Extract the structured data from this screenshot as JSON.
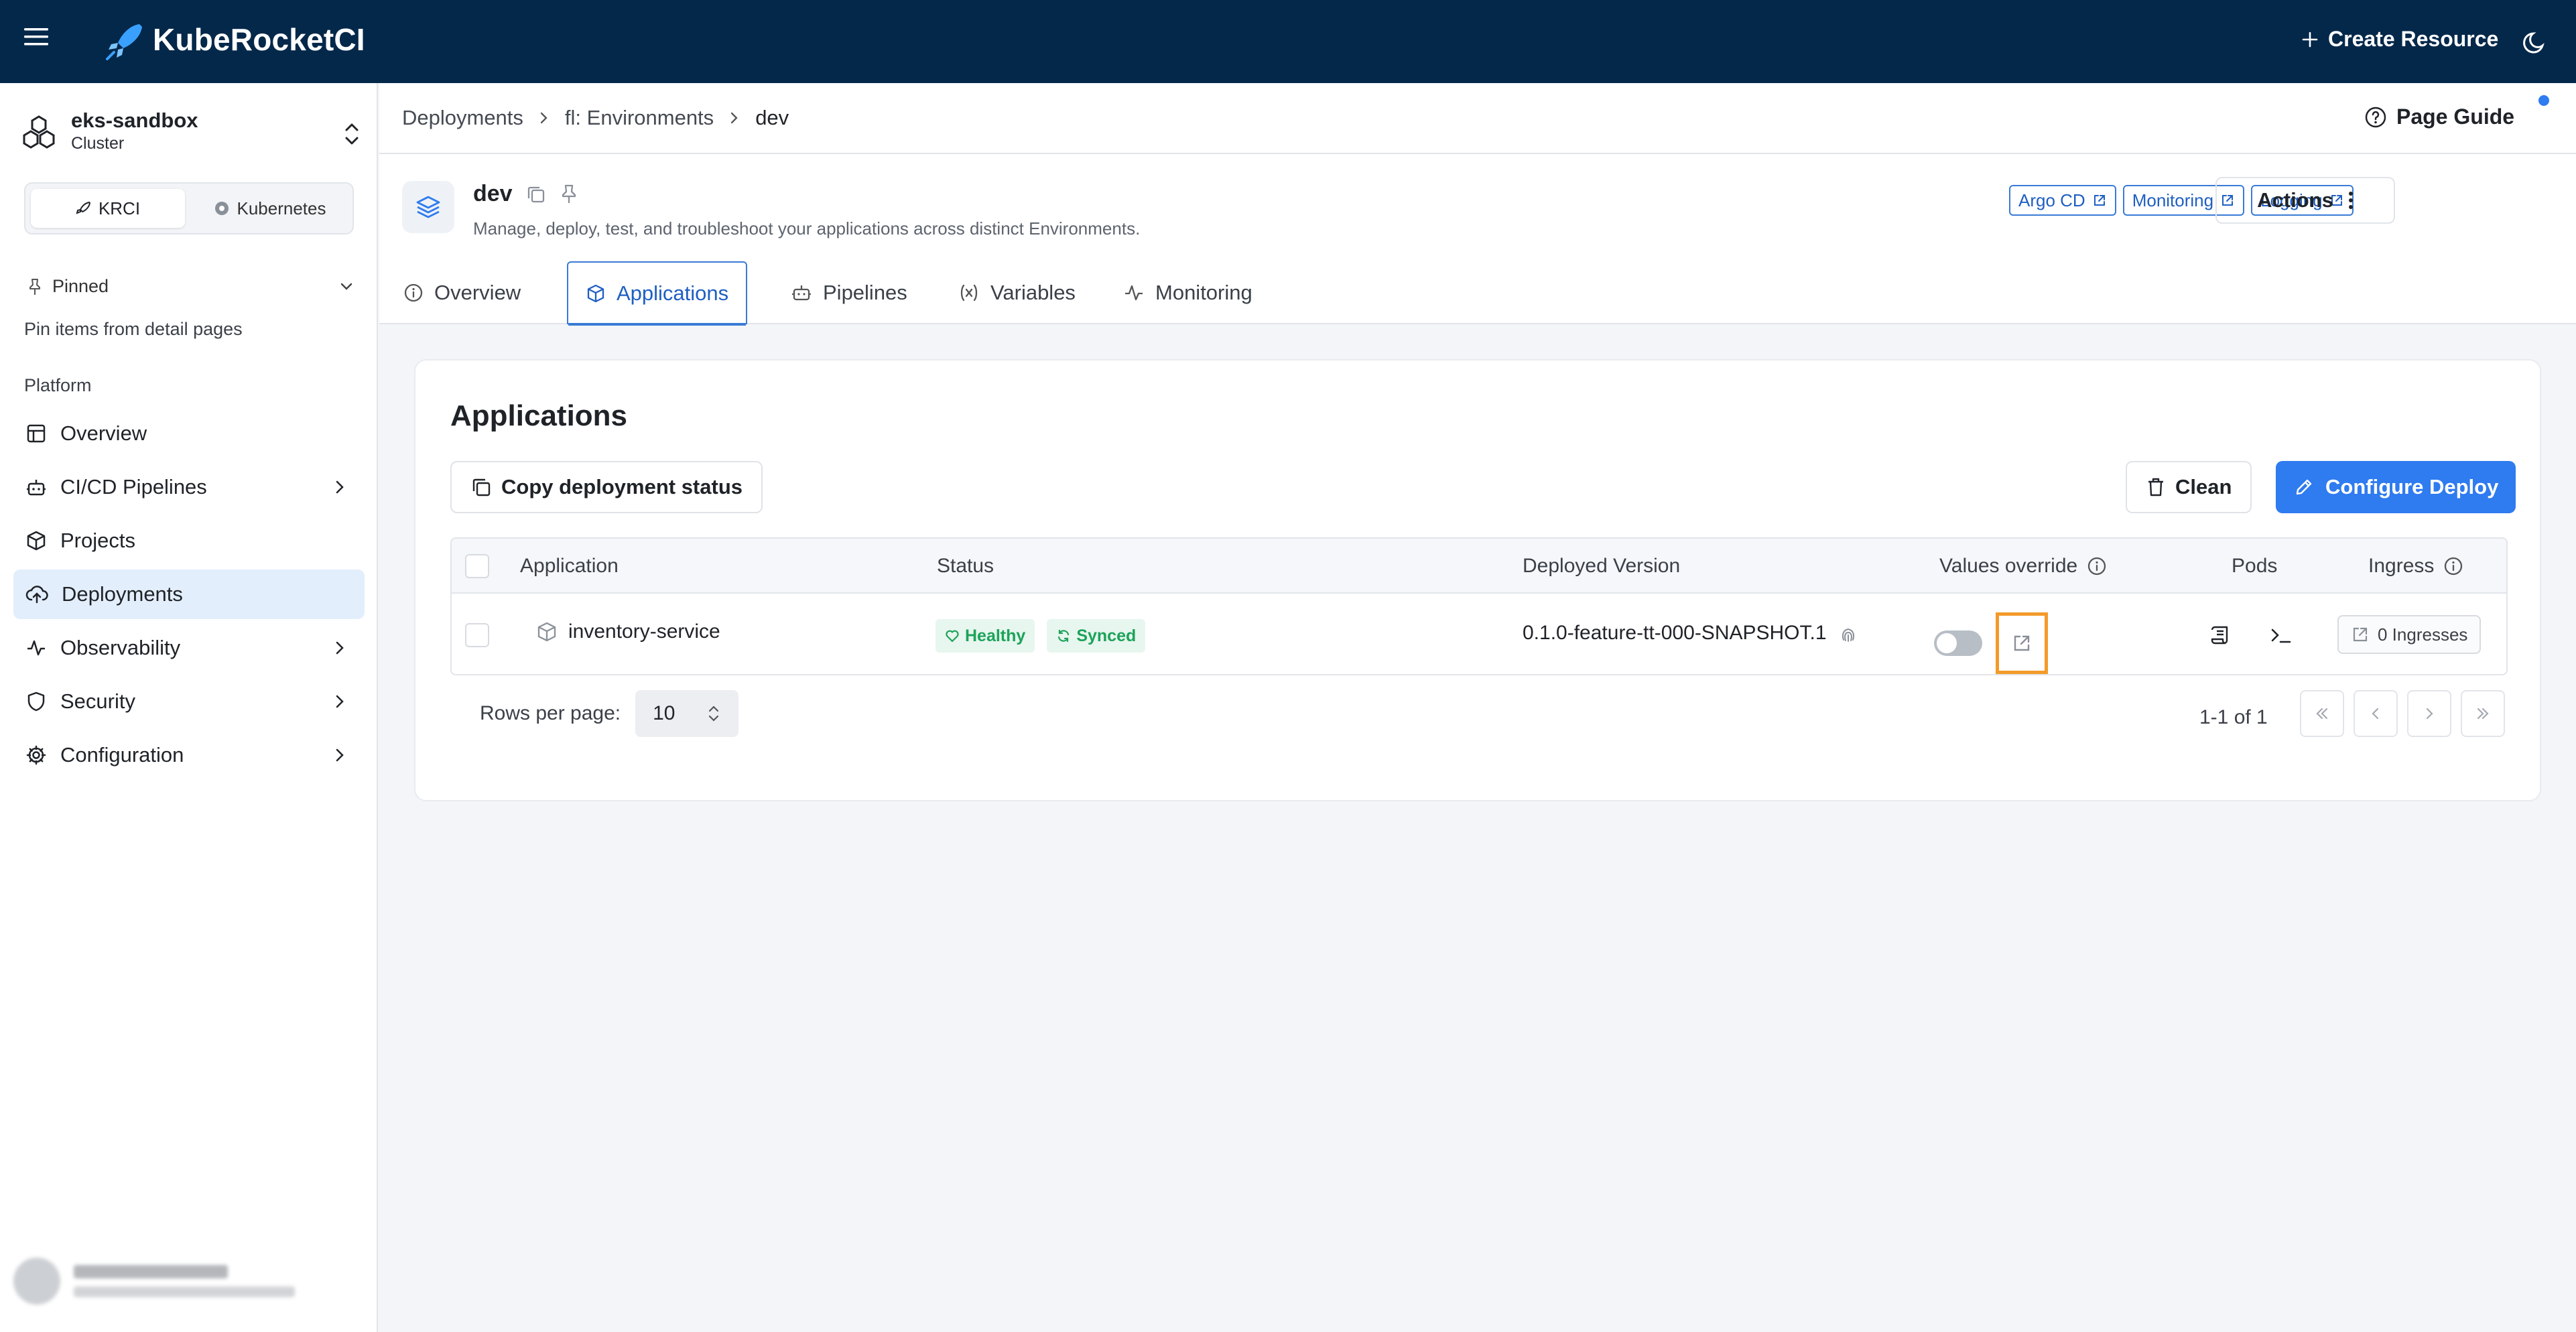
{
  "app": {
    "brand": "KubeRocketCI",
    "create_resource_label": "Create Resource"
  },
  "sidebar": {
    "cluster_name": "eks-sandbox",
    "cluster_type": "Cluster",
    "mode_options": [
      "KRCI",
      "Kubernetes"
    ],
    "active_mode": "KRCI",
    "pinned_label": "Pinned",
    "pinned_hint": "Pin items from detail pages",
    "section_label": "Platform",
    "items": [
      {
        "label": "Overview",
        "icon": "layout-icon",
        "expandable": false
      },
      {
        "label": "CI/CD Pipelines",
        "icon": "bot-icon",
        "expandable": true
      },
      {
        "label": "Projects",
        "icon": "box-icon",
        "expandable": false
      },
      {
        "label": "Deployments",
        "icon": "cloud-upload-icon",
        "expandable": false,
        "active": true
      },
      {
        "label": "Observability",
        "icon": "activity-icon",
        "expandable": true
      },
      {
        "label": "Security",
        "icon": "shield-icon",
        "expandable": true
      },
      {
        "label": "Configuration",
        "icon": "gear-icon",
        "expandable": true
      }
    ]
  },
  "breadcrumbs": [
    "Deployments",
    "fl: Environments",
    "dev"
  ],
  "page_guide_label": "Page Guide",
  "environment": {
    "name": "dev",
    "description": "Manage, deploy, test, and troubleshoot your applications across distinct Environments.",
    "links": [
      "Argo CD",
      "Monitoring",
      "Logging"
    ],
    "actions_label": "Actions"
  },
  "tabs": [
    {
      "label": "Overview",
      "icon": "info-icon"
    },
    {
      "label": "Applications",
      "icon": "box-icon",
      "active": true
    },
    {
      "label": "Pipelines",
      "icon": "bot-icon"
    },
    {
      "label": "Variables",
      "icon": "variable-icon"
    },
    {
      "label": "Monitoring",
      "icon": "activity-icon"
    }
  ],
  "applications": {
    "title": "Applications",
    "copy_status_label": "Copy deployment status",
    "clean_label": "Clean",
    "configure_label": "Configure Deploy",
    "columns": [
      "Application",
      "Status",
      "Deployed Version",
      "Values override",
      "Pods",
      "Ingress"
    ],
    "rows": [
      {
        "application": "inventory-service",
        "health": "Healthy",
        "sync": "Synced",
        "version": "0.1.0-feature-tt-000-SNAPSHOT.1",
        "values_override": false,
        "ingress": "0 Ingresses"
      }
    ],
    "rows_per_page_label": "Rows per page:",
    "rows_per_page": "10",
    "range_label": "1-1 of 1"
  },
  "colors": {
    "topbar": "#04284a",
    "primary": "#2f7bf0",
    "healthy": "#1ca35a",
    "highlight": "#f39a2b"
  }
}
